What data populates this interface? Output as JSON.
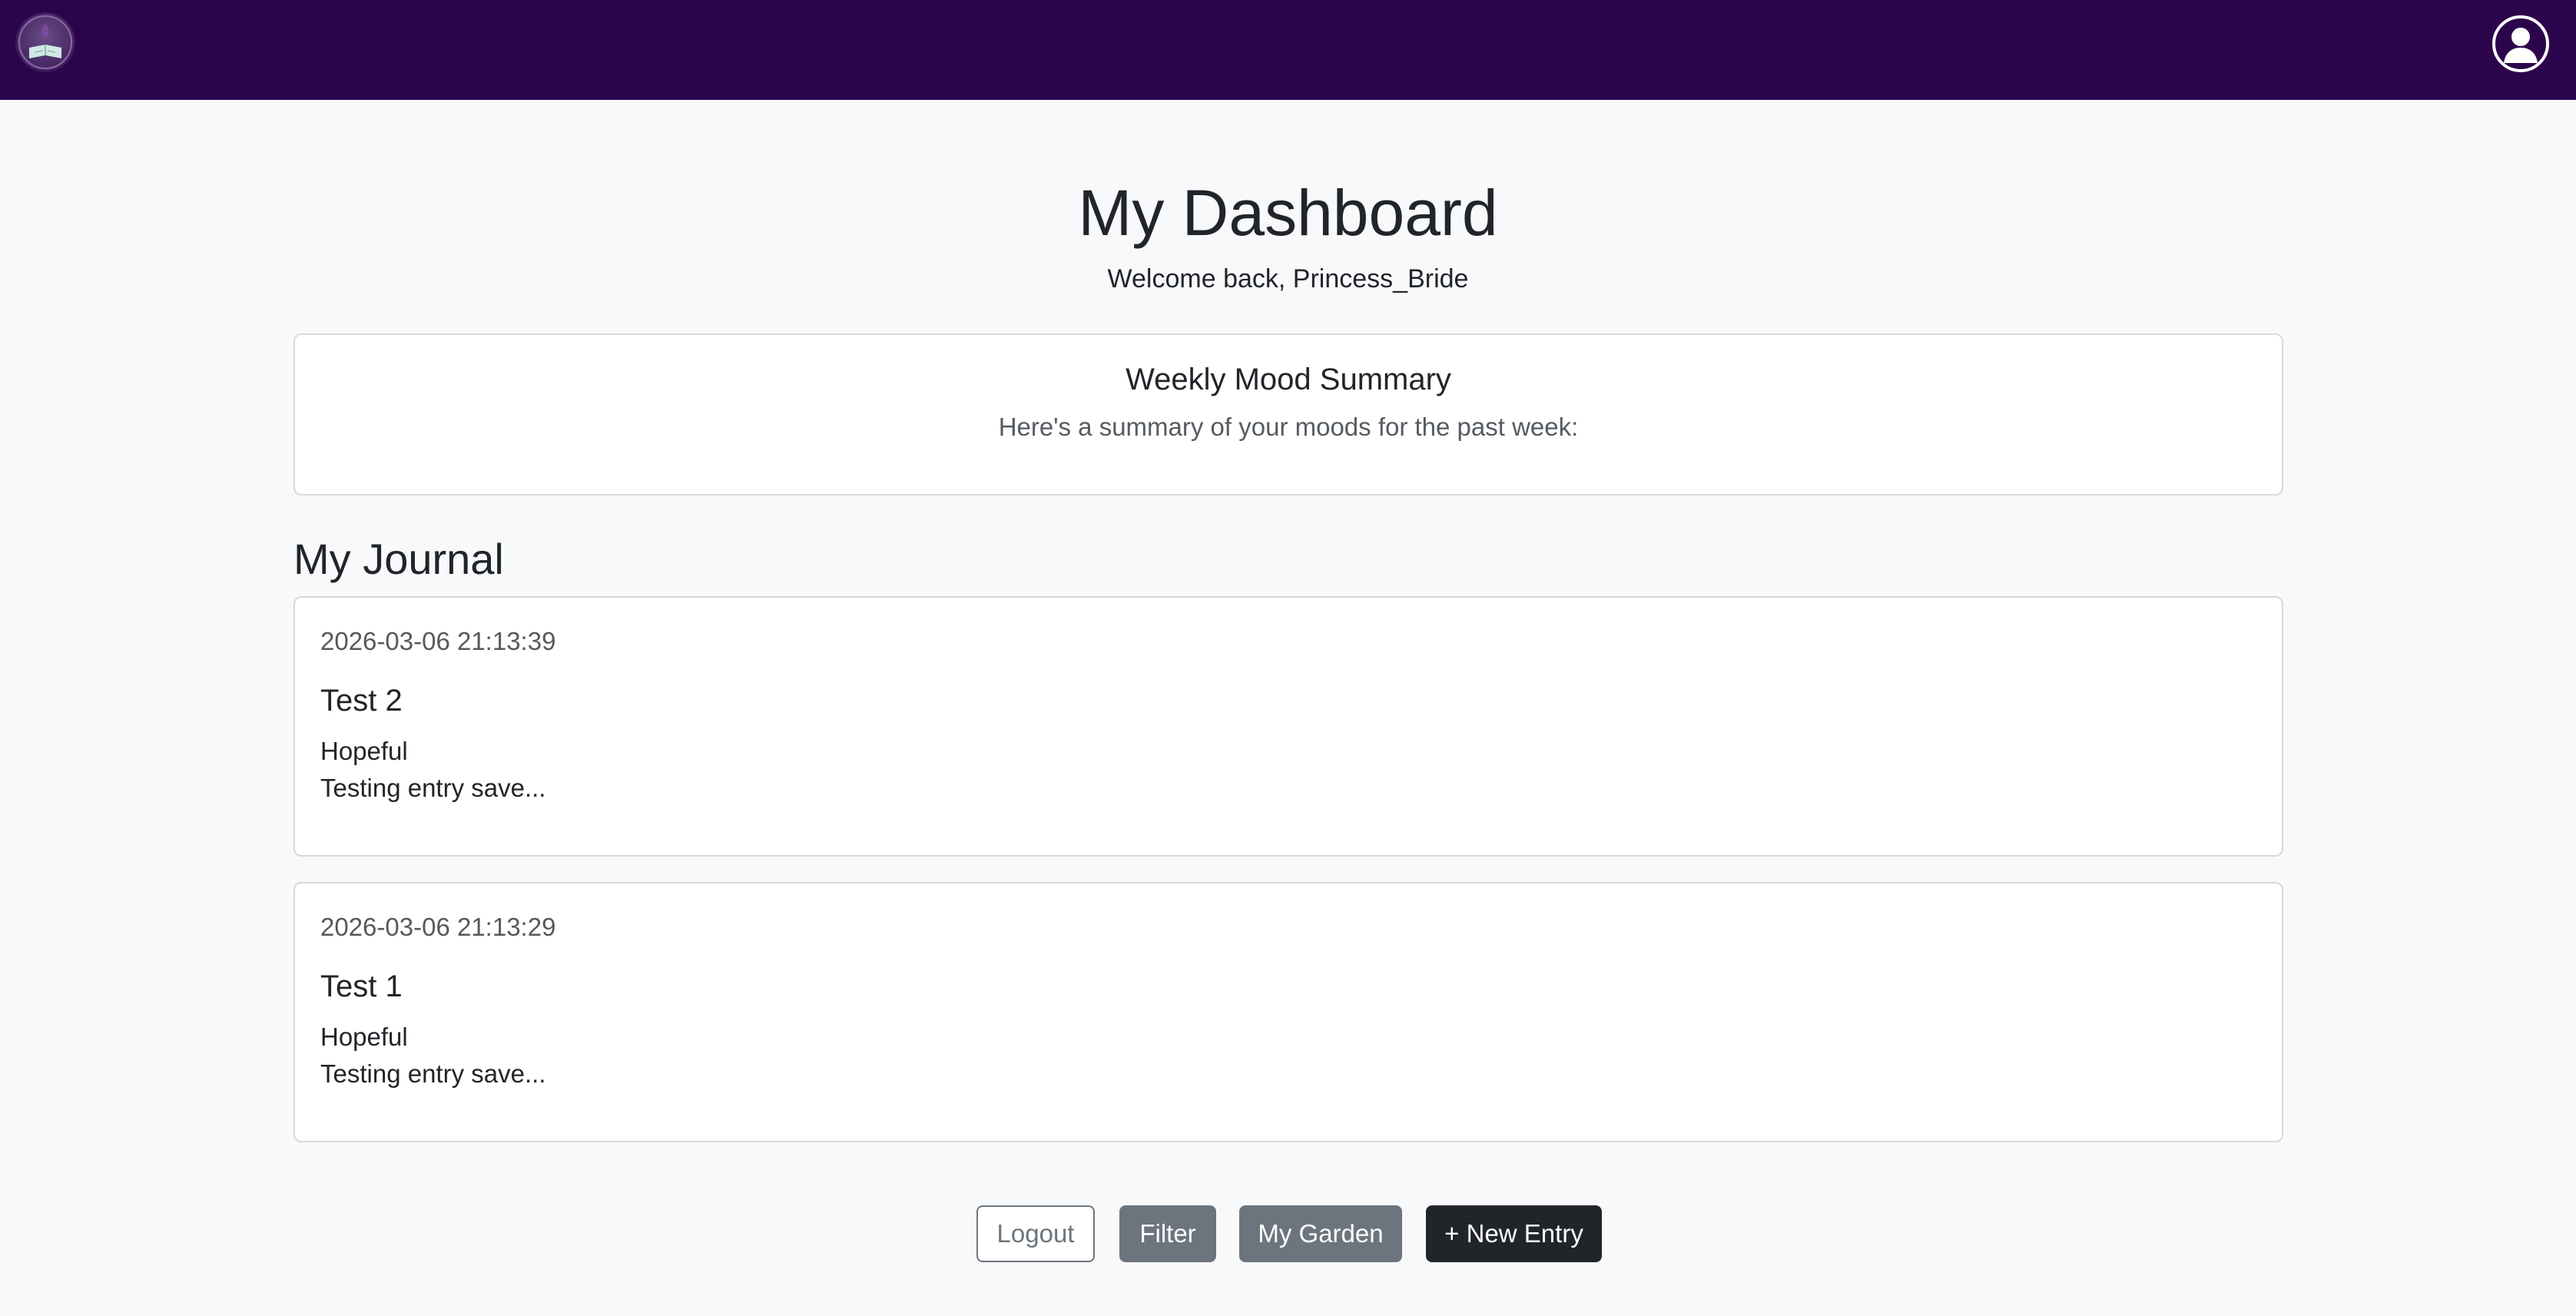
{
  "header": {
    "logo_icon": "journal-book-logo-icon",
    "profile_icon": "user-profile-icon",
    "background_color": "#2c044c"
  },
  "page": {
    "title": "My Dashboard",
    "welcome": "Welcome back, Princess_Bride"
  },
  "summary": {
    "title": "Weekly Mood Summary",
    "text": "Here's a summary of your moods for the past week:"
  },
  "journal": {
    "title": "My Journal",
    "entries": [
      {
        "date": "2026-03-06 21:13:39",
        "title": "Test 2",
        "mood": "Hopeful",
        "preview": "Testing entry save..."
      },
      {
        "date": "2026-03-06 21:13:29",
        "title": "Test 1",
        "mood": "Hopeful",
        "preview": "Testing entry save..."
      }
    ]
  },
  "actions": {
    "logout": "Logout",
    "filter": "Filter",
    "garden": "My Garden",
    "new_entry": "+ New Entry"
  }
}
